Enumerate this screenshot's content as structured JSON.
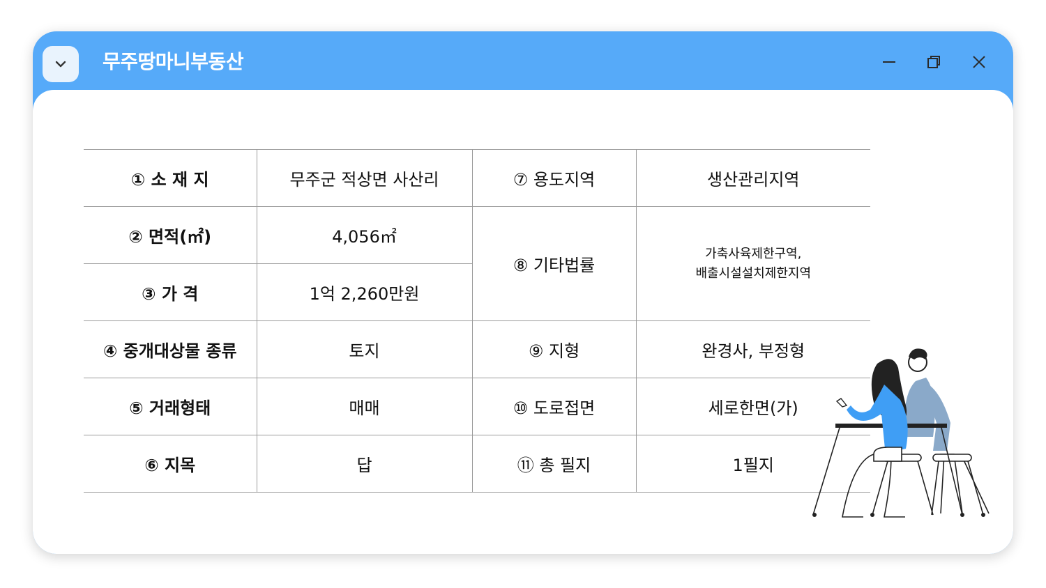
{
  "window": {
    "title": "무주땅마니부동산",
    "controls": {
      "minimize": "minimize-icon",
      "restore": "restore-icon",
      "close": "close-icon"
    },
    "menu_icon": "chevron-down-icon"
  },
  "colors": {
    "titlebar": "#56aaf9",
    "accent_figure": "#3f9ef5",
    "figure_secondary": "#8aa9c9"
  },
  "table": {
    "rows": [
      {
        "label1": "① 소 재 지",
        "value1": "무주군 적상면 사산리",
        "label2": "⑦ 용도지역",
        "value2": "생산관리지역"
      },
      {
        "label1": "② 면적(㎡)",
        "value1": "4,056㎡",
        "label2": "⑧ 기타법률",
        "value2_line1": "가축사육제한구역,",
        "value2_line2": "배출시설설치제한지역"
      },
      {
        "label1": "③ 가 격",
        "value1": "1억 2,260만원"
      },
      {
        "label1": "④ 중개대상물 종류",
        "value1": "토지",
        "label2": "⑨ 지형",
        "value2": "완경사, 부정형"
      },
      {
        "label1": "⑤ 거래형태",
        "value1": "매매",
        "label2": "⑩ 도로접면",
        "value2": "세로한면(가)"
      },
      {
        "label1": "⑥  지목",
        "value1": "답",
        "label2": "⑪ 총 필지",
        "value2": "1필지"
      }
    ]
  }
}
